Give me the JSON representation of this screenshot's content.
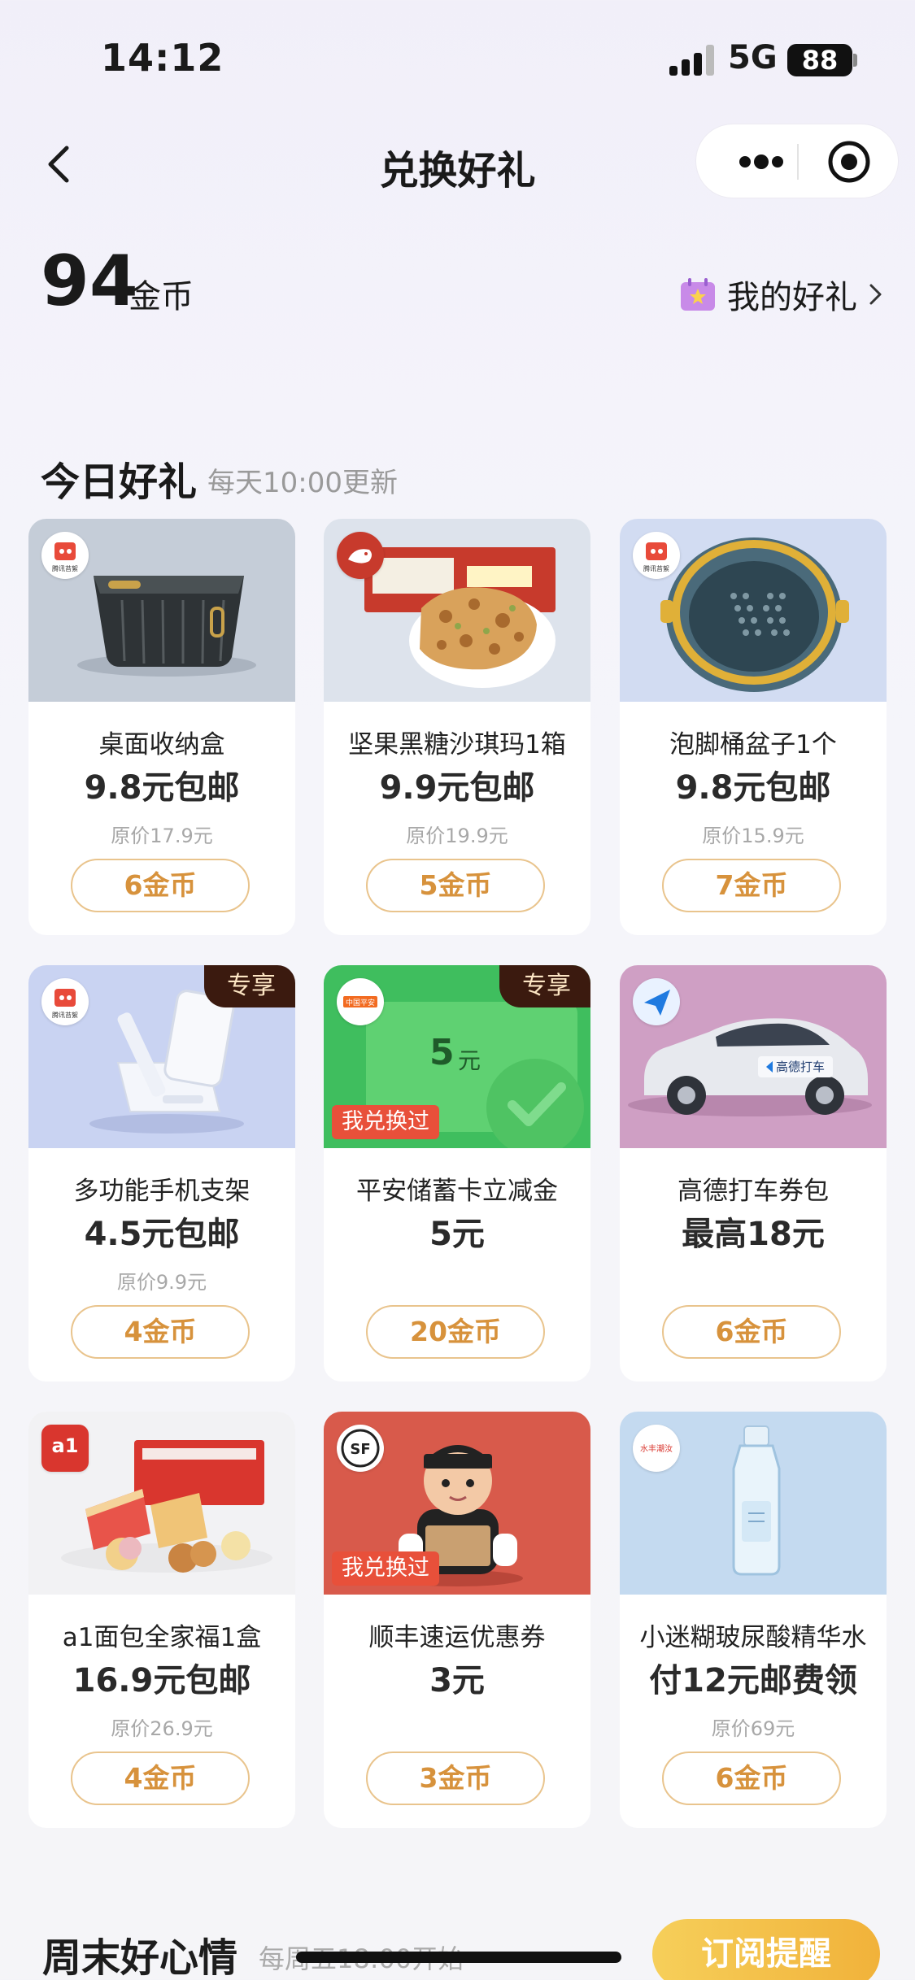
{
  "status_bar": {
    "time": "14:12",
    "network": "5G",
    "battery": "88"
  },
  "nav": {
    "title": "兑换好礼"
  },
  "header": {
    "coin_count": "94",
    "coin_unit": "金币",
    "my_gifts": "我的好礼"
  },
  "section": {
    "title": "今日好礼",
    "subtitle": "每天10:00更新"
  },
  "items": [
    {
      "name": "桌面收纳盒",
      "price": "9.8元包邮",
      "original": "原价17.9元",
      "cost": "6金币",
      "tag": ""
    },
    {
      "name": "坚果黑糖沙琪玛1箱",
      "price": "9.9元包邮",
      "original": "原价19.9元",
      "cost": "5金币",
      "tag": ""
    },
    {
      "name": "泡脚桶盆子1个",
      "price": "9.8元包邮",
      "original": "原价15.9元",
      "cost": "7金币",
      "tag": ""
    },
    {
      "name": "多功能手机支架",
      "price": "4.5元包邮",
      "original": "原价9.9元",
      "cost": "4金币",
      "tag": "专享"
    },
    {
      "name": "平安储蓄卡立减金",
      "price": "5元",
      "original": "",
      "cost": "20金币",
      "tag": "专享",
      "redeemed": "我兑换过",
      "card_value": "5",
      "card_unit": "元"
    },
    {
      "name": "高德打车券包",
      "price": "最高18元",
      "original": "",
      "cost": "6金币",
      "tag": "",
      "car_text": "高德打车"
    },
    {
      "name": "a1面包全家福1盒",
      "price": "16.9元包邮",
      "original": "原价26.9元",
      "cost": "4金币",
      "tag": ""
    },
    {
      "name": "顺丰速运优惠券",
      "price": "3元",
      "original": "",
      "cost": "3金币",
      "tag": "",
      "redeemed": "我兑换过"
    },
    {
      "name": "小迷糊玻尿酸精华水",
      "price": "付12元邮费领",
      "original": "原价69元",
      "cost": "6金币",
      "tag": ""
    }
  ],
  "brands": {
    "tencent": "腾讯苔絮",
    "pingan": "中国平安",
    "a1": "a1",
    "sf": "SF",
    "shuifeng": "水丰潮汝"
  },
  "weekend": {
    "title": "周末好心情",
    "subtitle": "每周五18:00开始",
    "subscribe": "订阅提醒"
  },
  "colors": {
    "accent": "#d7923c",
    "button_border": "#e9c48d",
    "exclusive_tag": "#3b1a0f",
    "redeemed_tag": "#e8503a"
  }
}
